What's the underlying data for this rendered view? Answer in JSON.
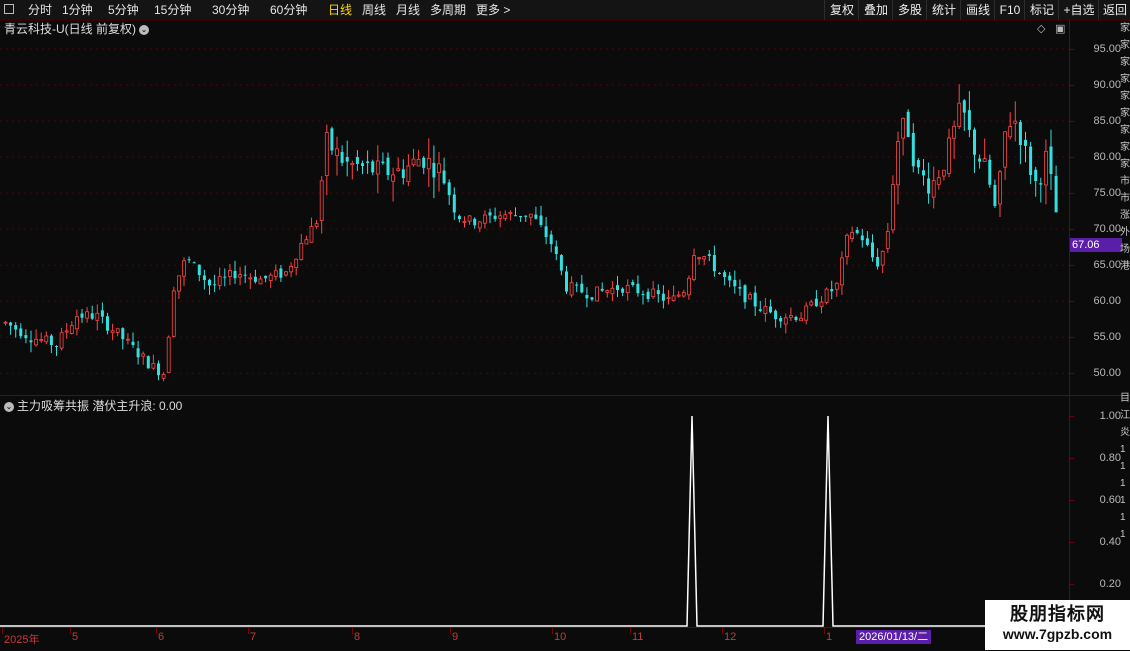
{
  "toolbar": {
    "periods": [
      "分时",
      "1分钟",
      "5分钟",
      "15分钟",
      "30分钟",
      "60分钟",
      "日线",
      "周线",
      "月线",
      "多周期",
      "更多 >"
    ],
    "active_period": "日线",
    "right_buttons": [
      "复权",
      "叠加",
      "多股",
      "统计",
      "画线",
      "F10",
      "标记",
      "+自选",
      "返回"
    ]
  },
  "stock_title": "青云科技-U(日线 前复权)",
  "price_axis": {
    "labels": [
      "95.00",
      "90.00",
      "85.00",
      "80.00",
      "75.00",
      "70.00",
      "65.00",
      "60.00",
      "55.00",
      "50.00"
    ],
    "current_price": "67.06"
  },
  "indicator": {
    "title": "主力吸筹共振  潜伏主升浪: 0.00",
    "axis_labels": [
      "1.00",
      "0.80",
      "0.60",
      "0.40",
      "0.20"
    ]
  },
  "date_axis": {
    "labels": [
      "2025年",
      "5",
      "6",
      "7",
      "8",
      "9",
      "10",
      "11",
      "12",
      "1"
    ],
    "cursor_date": "2026/01/13/二"
  },
  "right_strip": [
    "家",
    "家",
    "家",
    "家",
    "家",
    "家",
    "家",
    "家",
    "家",
    "市",
    "市",
    "涨",
    "外",
    "场",
    "港"
  ],
  "right_strip2": [
    "目",
    "江",
    "炎",
    "1",
    "1",
    "1",
    "1",
    "1",
    "1"
  ],
  "watermark": {
    "line1": "股朋指标网",
    "line2": "www.7gpzb.com"
  },
  "colors": {
    "up": "#ff4444",
    "down": "#33e0e0",
    "axis": "#7a0000",
    "active": "#ffd800",
    "highlight": "#5a1ea8"
  },
  "chart_data": {
    "type": "candlestick",
    "ylim": [
      47,
      99
    ],
    "signal_series": {
      "name": "潜伏主升浪",
      "peaks_at_months": [
        "11",
        "12"
      ],
      "values_range": [
        0,
        1
      ]
    }
  }
}
